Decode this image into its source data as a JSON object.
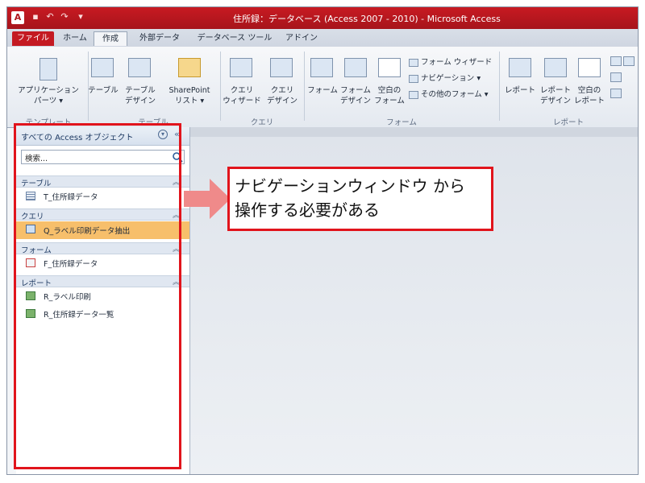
{
  "window": {
    "title": "住所録：データベース (Access 2007 - 2010) - Microsoft Access",
    "app_icon": "A"
  },
  "quick_access": {
    "icons": [
      "save-icon",
      "undo-icon",
      "redo-icon",
      "customize-icon"
    ]
  },
  "ribbon_tabs": [
    "ファイル",
    "ホーム",
    "作成",
    "外部データ",
    "データベース ツール",
    "アドイン"
  ],
  "ribbon": {
    "groups": {
      "template": {
        "label": "テンプレート",
        "app_parts": "アプリケーション\nパーツ ▾"
      },
      "table": {
        "label": "テーブル",
        "table": "テーブル",
        "table_design": "テーブル\nデザイン",
        "sharepoint": "SharePoint\nリスト ▾"
      },
      "query": {
        "label": "クエリ",
        "query_wizard": "クエリ\nウィザード",
        "query_design": "クエリ\nデザイン"
      },
      "form": {
        "label": "フォーム",
        "form": "フォーム",
        "form_design": "フォーム\nデザイン",
        "blank_form": "空白の\nフォーム",
        "form_wizard": "フォーム ウィザード",
        "navigation": "ナビゲーション ▾",
        "more_forms": "その他のフォーム ▾"
      },
      "report": {
        "label": "レポート",
        "report": "レポート",
        "report_design": "レポート\nデザイン",
        "blank_report": "空白の\nレポート"
      }
    }
  },
  "nav_pane": {
    "title": "すべての Access オブジェクト",
    "search_placeholder": "検索...",
    "groups": [
      {
        "label": "テーブル",
        "items": [
          "T_住所録データ"
        ]
      },
      {
        "label": "クエリ",
        "items": [
          "Q_ラベル印刷データ抽出"
        ]
      },
      {
        "label": "フォーム",
        "items": [
          "F_住所録データ"
        ]
      },
      {
        "label": "レポート",
        "items": [
          "R_ラベル印刷",
          "R_住所録データ一覧"
        ]
      }
    ]
  },
  "callout": {
    "text": "ナビゲーションウィンドウ から\n操作する必要がある"
  },
  "colors": {
    "title_bar": "#b0151c",
    "annotation": "#e1141c",
    "selected_item": "#f7bf6b"
  }
}
